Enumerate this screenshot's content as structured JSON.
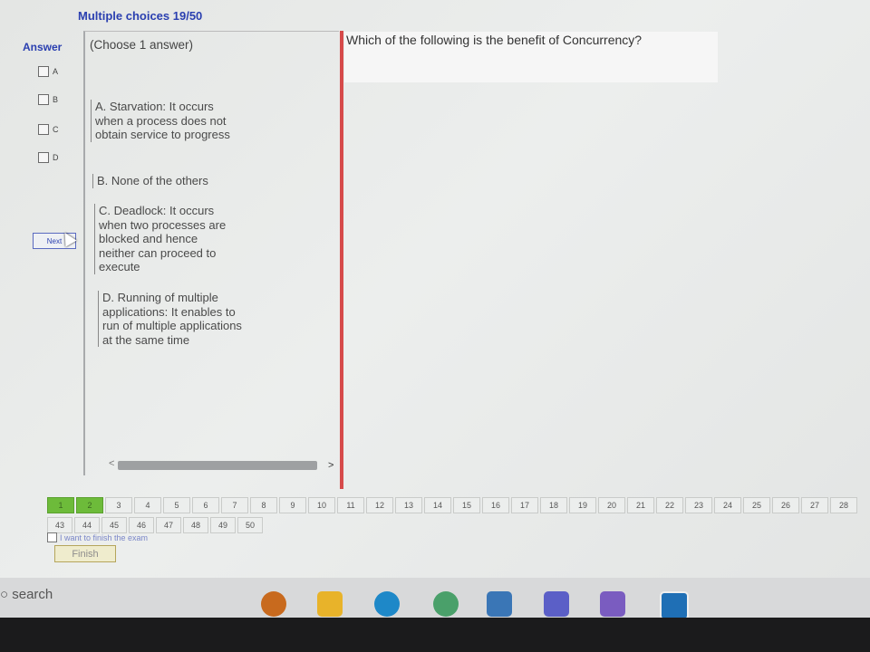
{
  "header": {
    "title": "Multiple choices 19/50",
    "answer_label": "Answer"
  },
  "answer_options": [
    "A",
    "B",
    "C",
    "D"
  ],
  "next_button": "Next",
  "choose_hint": "(Choose 1 answer)",
  "question": "Which of the following is the benefit of Concurrency?",
  "choices": [
    {
      "label": "A. Starvation: It occurs when a process does not obtain service to progress"
    },
    {
      "label": "B. None of the others"
    },
    {
      "label": "C. Deadlock: It occurs when two processes are blocked and hence neither can proceed to execute"
    },
    {
      "label": "D. Running of multiple applications: It enables to run of multiple applications at the same time"
    }
  ],
  "scroll_arrows": {
    "left": "<",
    "right": ">"
  },
  "question_nav": {
    "row1": [
      "1",
      "2",
      "3",
      "4",
      "5",
      "6",
      "7",
      "8",
      "9",
      "10",
      "11",
      "12",
      "13",
      "14",
      "15",
      "16",
      "17",
      "18",
      "19",
      "20",
      "21",
      "22",
      "23",
      "24",
      "25",
      "26",
      "27",
      "28"
    ],
    "row2": [
      "43",
      "44",
      "45",
      "46",
      "47",
      "48",
      "49",
      "50"
    ],
    "answered": [
      "1",
      "2"
    ]
  },
  "finish_checkbox_label": "I want to finish the exam",
  "finish_button": "Finish",
  "taskbar": {
    "search": "search"
  },
  "colors": {
    "title_blue": "#2a3fb0",
    "divider_red": "#d64a4a",
    "answered_green": "#6dbb3a"
  }
}
